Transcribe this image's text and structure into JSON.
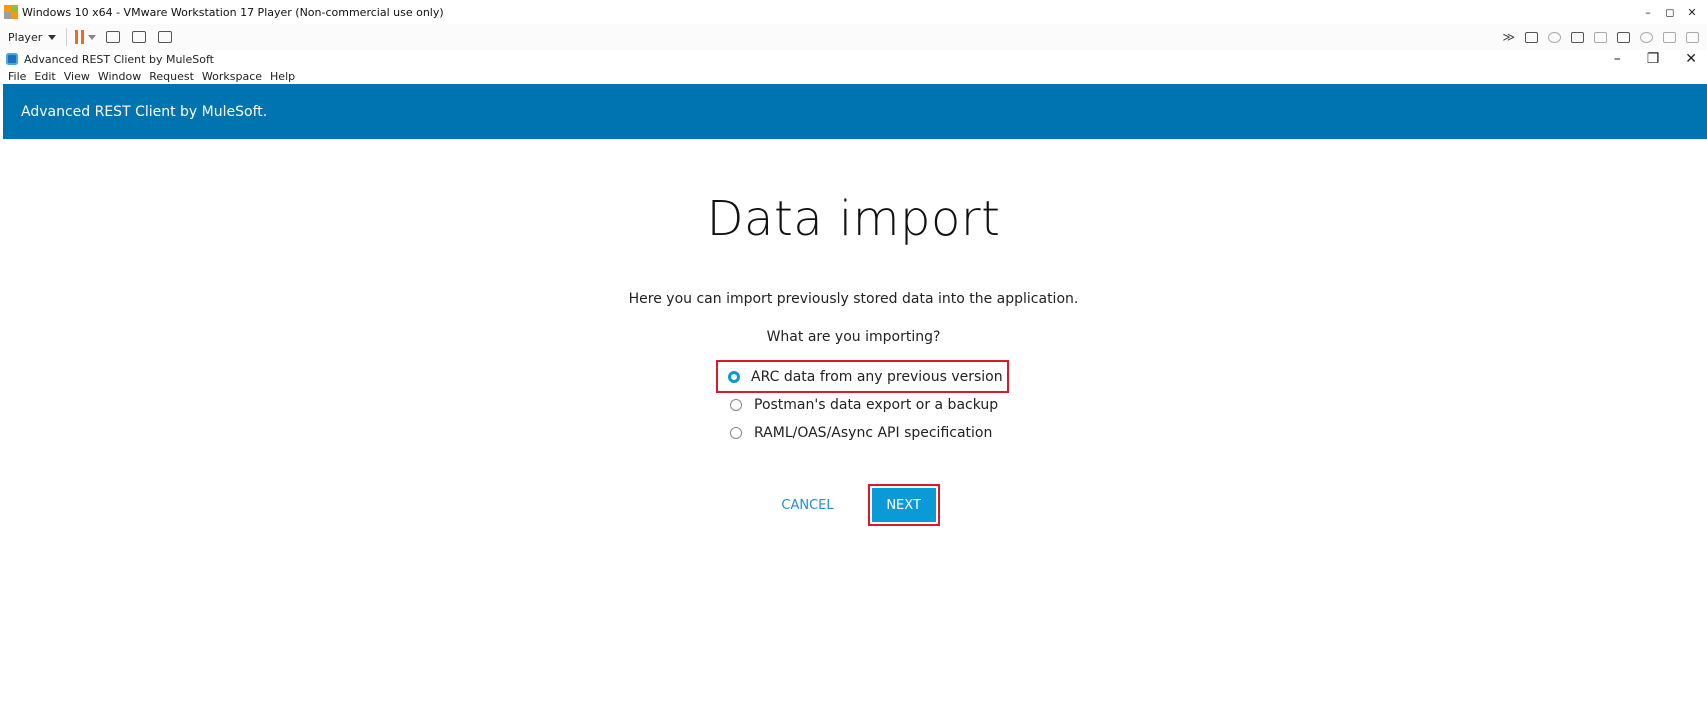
{
  "vmware": {
    "title": "Windows 10 x64 - VMware Workstation 17 Player (Non-commercial use only)",
    "player_label": "Player",
    "window_controls": {
      "minimize": "–",
      "maximize": "◻",
      "close": "✕"
    }
  },
  "app": {
    "title": "Advanced REST Client by MuleSoft",
    "window_controls": {
      "minimize": "–",
      "restore": "❐",
      "close": "✕"
    },
    "menu": [
      "File",
      "Edit",
      "View",
      "Window",
      "Request",
      "Workspace",
      "Help"
    ],
    "banner_title": "Advanced REST Client by MuleSoft."
  },
  "import": {
    "heading": "Data import",
    "description": "Here you can import previously stored data into the application.",
    "question": "What are you importing?",
    "options": [
      {
        "label": "ARC data from any previous version",
        "selected": true
      },
      {
        "label": "Postman's data export or a backup",
        "selected": false
      },
      {
        "label": "RAML/OAS/Async API specification",
        "selected": false
      }
    ],
    "cancel_label": "CANCEL",
    "next_label": "NEXT"
  },
  "colors": {
    "banner": "#0074b0",
    "accent": "#0a9ad8",
    "highlight": "#d81b2c",
    "pause": "#f26a21"
  }
}
